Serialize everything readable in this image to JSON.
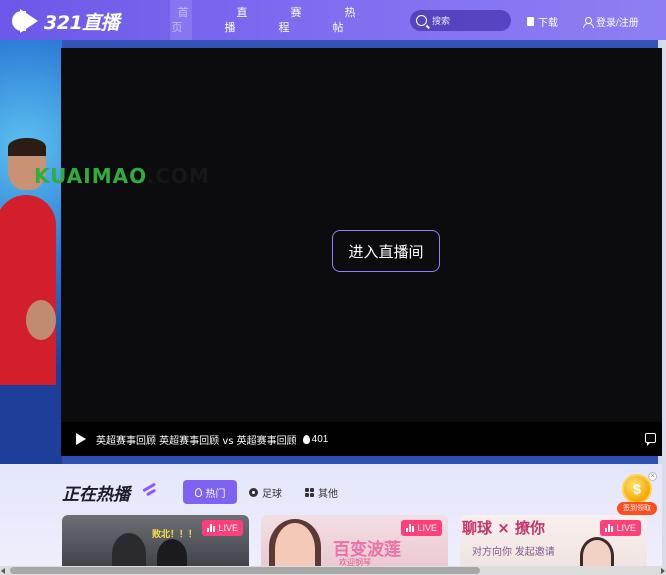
{
  "brand": {
    "logo_text": "321直播"
  },
  "nav": {
    "items": [
      {
        "label": "首页",
        "chars": [
          "首",
          "页"
        ],
        "active": true
      },
      {
        "label": "直播",
        "chars": [
          "直",
          "播"
        ],
        "active": false
      },
      {
        "label": "赛程",
        "chars": [
          "赛",
          "程"
        ],
        "active": false
      },
      {
        "label": "热帖",
        "chars": [
          "热",
          "帖"
        ],
        "active": false
      }
    ]
  },
  "search": {
    "placeholder": "搜索"
  },
  "header_actions": {
    "download": "下载",
    "login": "登录/注册"
  },
  "hero": {
    "watermark_green": "KUAIMAO",
    "watermark_dark": ".COM"
  },
  "player": {
    "enter_button": "进入直播间",
    "title": "英超赛事回顾 英超赛事回顾 vs 英超赛事回顾",
    "viewers": "401"
  },
  "hot": {
    "title": "正在热播",
    "tabs": [
      {
        "label": "热门",
        "icon": "flame-icon",
        "active": true
      },
      {
        "label": "足球",
        "icon": "soccer-ball-icon",
        "active": false
      },
      {
        "label": "其他",
        "icon": "grid-icon",
        "active": false
      }
    ],
    "cards": [
      {
        "live": "LIVE",
        "caption": "败北！！！"
      },
      {
        "live": "LIVE",
        "caption": "百变波莲",
        "sub": "欢迎钢琴"
      },
      {
        "live": "LIVE",
        "caption": "聊球 × 撩你",
        "sub": "对方向你 发起邀请"
      }
    ]
  },
  "checkin": {
    "label": "签到领取",
    "close": "×"
  },
  "colors": {
    "accent": "#7d63f0",
    "live": "#ff3f7a",
    "nav_bg": "#6b58e8"
  }
}
